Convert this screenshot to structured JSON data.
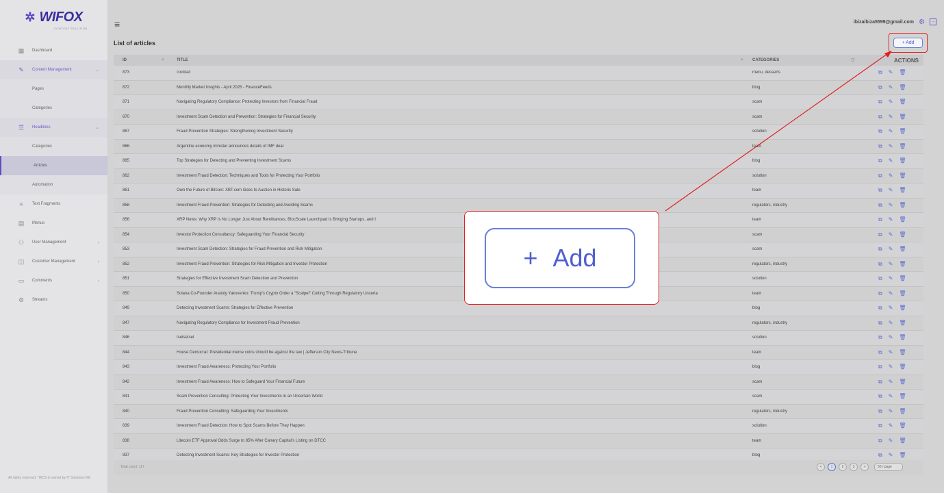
{
  "brand": {
    "logo_text": "WIFOX",
    "logo_sub": "CONTENT SOLUTION"
  },
  "sidebar": {
    "items": [
      {
        "label": "Dashboard",
        "icon": "dashboard-icon"
      },
      {
        "label": "Content Management",
        "icon": "content-icon"
      },
      {
        "label": "Pages"
      },
      {
        "label": "Categories"
      },
      {
        "label": "Headlines",
        "icon": "headlines-icon"
      },
      {
        "label": "Categories"
      },
      {
        "label": "Articles"
      },
      {
        "label": "Automation"
      },
      {
        "label": "Text Fragments",
        "icon": "text-icon"
      },
      {
        "label": "Menus",
        "icon": "menus-icon"
      },
      {
        "label": "User Management",
        "icon": "users-icon"
      },
      {
        "label": "Customer Management",
        "icon": "customer-icon"
      },
      {
        "label": "Comments",
        "icon": "comments-icon"
      },
      {
        "label": "Streams",
        "icon": "streams-icon"
      }
    ],
    "footer": "All rights reserved. \"WCS is owned by IT Solutions RD"
  },
  "header": {
    "user_email": "ibizaibiza5599@gmail.com"
  },
  "page": {
    "title": "List of articles",
    "add_label": "+ Add"
  },
  "table": {
    "columns": {
      "id": "ID",
      "title": "TITLE",
      "categories": "CATEGORIES",
      "actions": "ACTIONS"
    },
    "rows": [
      [
        "873",
        "cocktail",
        "menu, desserts"
      ],
      [
        "872",
        "Monthly Market Insights - April 2025 - FinanceFeeds",
        "blog"
      ],
      [
        "871",
        "Navigating Regulatory Compliance: Protecting Investors from Financial Fraud",
        "scam"
      ],
      [
        "870",
        "Investment Scam Detection and Prevention: Strategies for Financial Security",
        "scam"
      ],
      [
        "867",
        "Fraud Prevention Strategies: Strengthening Investment Security",
        "solution"
      ],
      [
        "866",
        "Argentine economy minister announces details of IMF deal",
        "team"
      ],
      [
        "865",
        "Top Strategies for Detecting and Preventing Investment Scams",
        "blog"
      ],
      [
        "862",
        "Investment Fraud Detection: Techniques and Tools for Protecting Your Portfolio",
        "solution"
      ],
      [
        "861",
        "Own the Future of Bitcoin: XBT.com Goes to Auction in Historic Sale",
        "team"
      ],
      [
        "858",
        "Investment Fraud Prevention: Strategies for Detecting and Avoiding Scams",
        "regulators, industry"
      ],
      [
        "856",
        "XRP News: Why XRP Is No Longer Just About Remittances, BlocScale Launchpad Is Bringing Startups, and I",
        "team"
      ],
      [
        "854",
        "Investor Protection Consultancy: Safeguarding Your Financial Security",
        "scam"
      ],
      [
        "853",
        "Investment Scam Detection: Strategies for Fraud Prevention and Risk Mitigation",
        "scam"
      ],
      [
        "852",
        "Investment Fraud Prevention: Strategies for Risk Mitigation and Investor Protection",
        "regulators, industry"
      ],
      [
        "851",
        "Strategies for Effective Investment Scam Detection and Prevention",
        "solution"
      ],
      [
        "850",
        "Solana Co-Founder Anatoly Yakovenko: Trump's Crypto Order a \"Scalpel\" Cutting Through Regulatory Uncerta",
        "team"
      ],
      [
        "849",
        "Detecting Investment Scams: Strategies for Effective Prevention",
        "blog"
      ],
      [
        "847",
        "Navigating Regulatory Compliance for Investment Fraud Prevention",
        "regulators, industry"
      ],
      [
        "846",
        "tsetsetset",
        "solution"
      ],
      [
        "844",
        "House Democrat: Presidential meme coins should be against the law | Jefferson City News-Tribune",
        "team"
      ],
      [
        "843",
        "Investment Fraud Awareness: Protecting Your Portfolio",
        "blog"
      ],
      [
        "842",
        "Investment Fraud Awareness: How to Safeguard Your Financial Future",
        "scam"
      ],
      [
        "841",
        "Scam Prevention Consulting: Protecting Your Investments in an Uncertain World",
        "scam"
      ],
      [
        "840",
        "Fraud Prevention Consulting: Safeguarding Your Investments",
        "regulators, industry"
      ],
      [
        "839",
        "Investment Fraud Detection: How to Spot Scams Before They Happen",
        "solution"
      ],
      [
        "838",
        "Litecoin ETF Approval Odds Surge to 85% After Canary Capital's Listing on DTCC",
        "team"
      ],
      [
        "837",
        "Detecting Investment Scams: Key Strategies for Investor Protection",
        "blog"
      ]
    ],
    "total": "Total count: 117"
  },
  "pagination": {
    "pages": [
      "1",
      "2",
      "3"
    ],
    "prev": "<",
    "next": ">",
    "per_page": "50 / page"
  },
  "callout": {
    "label": "Add",
    "plus": "+"
  },
  "colors": {
    "accent": "#5b6fd0",
    "highlight": "#e02020"
  }
}
